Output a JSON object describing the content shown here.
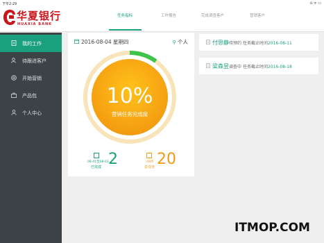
{
  "status_bar": {
    "time": "下午2:29",
    "icons": "⊙ ᯤ ▭"
  },
  "brand": {
    "name": "华夏银行",
    "sub": "HUAXIA BANK"
  },
  "tabs": [
    {
      "label": "任务指标",
      "active": true
    },
    {
      "label": "工作报告",
      "active": false
    },
    {
      "label": "完成调查客户",
      "active": false
    },
    {
      "label": "营销客户",
      "active": false
    }
  ],
  "sidebar": {
    "items": [
      {
        "label": "我的工作",
        "icon": "document-icon",
        "active": true
      },
      {
        "label": "待跟进客户",
        "icon": "follow-user-icon",
        "active": false
      },
      {
        "label": "开始营销",
        "icon": "target-icon",
        "active": false
      },
      {
        "label": "产品包",
        "icon": "briefcase-icon",
        "active": false
      },
      {
        "label": "个人中心",
        "icon": "person-icon",
        "active": false
      }
    ]
  },
  "task_summary": {
    "date": "2016-08-04 星期四",
    "scope": "个人",
    "percent_text": "10%",
    "percent_value": 10,
    "caption": "营销任务完成度",
    "completed": {
      "range": "08-01至08-03",
      "label": "已完成",
      "value": "2"
    },
    "total": {
      "range": "08月",
      "label": "总任务",
      "value": "20"
    }
  },
  "tasks": [
    {
      "name": "付思静",
      "status": "待预约",
      "due_label": "任务截止时间",
      "due_date": "2016-08-11"
    },
    {
      "name": "梁森昱",
      "status": "调查中",
      "due_label": "任务截止时间",
      "due_date": "2016-08-18"
    }
  ],
  "watermark": "ITMOP.COM",
  "colors": {
    "accent": "#1aa07e",
    "brand_red": "#c8161d",
    "sidebar_bg": "#3b4347",
    "gauge_orange": "#f5a00d",
    "ring": "#f6e2b4",
    "total_orange": "#f39a1a"
  }
}
